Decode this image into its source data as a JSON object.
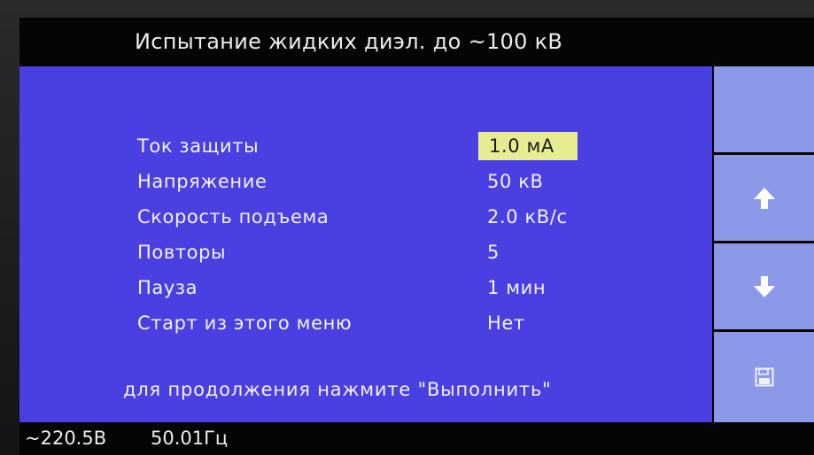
{
  "header": {
    "title": "Испытание жидких диэл. до ~100 кВ"
  },
  "params": [
    {
      "label": "Ток защиты",
      "value": "1.0 мА",
      "selected": true
    },
    {
      "label": "Напряжение",
      "value": "50 кВ",
      "selected": false
    },
    {
      "label": "Скорость подъема",
      "value": "2.0 кВ/с",
      "selected": false
    },
    {
      "label": "Повторы",
      "value": "5",
      "selected": false
    },
    {
      "label": "Пауза",
      "value": "1 мин",
      "selected": false
    },
    {
      "label": "Старт из этого меню",
      "value": "Нет",
      "selected": false
    }
  ],
  "hint": "для продолжения нажмите \"Выполнить\"",
  "sidebar": {
    "buttons": [
      {
        "icon": "blank"
      },
      {
        "icon": "arrow-up-icon"
      },
      {
        "icon": "arrow-down-icon"
      },
      {
        "icon": "save-icon"
      }
    ]
  },
  "status": {
    "voltage": "~220.5В",
    "frequency": "50.01Гц"
  },
  "colors": {
    "panel": "#4a3fe0",
    "sidebar_button": "#8c99e9",
    "selected_value": "#e7ec93",
    "text": "#f2f2f2",
    "background": "#050505"
  }
}
